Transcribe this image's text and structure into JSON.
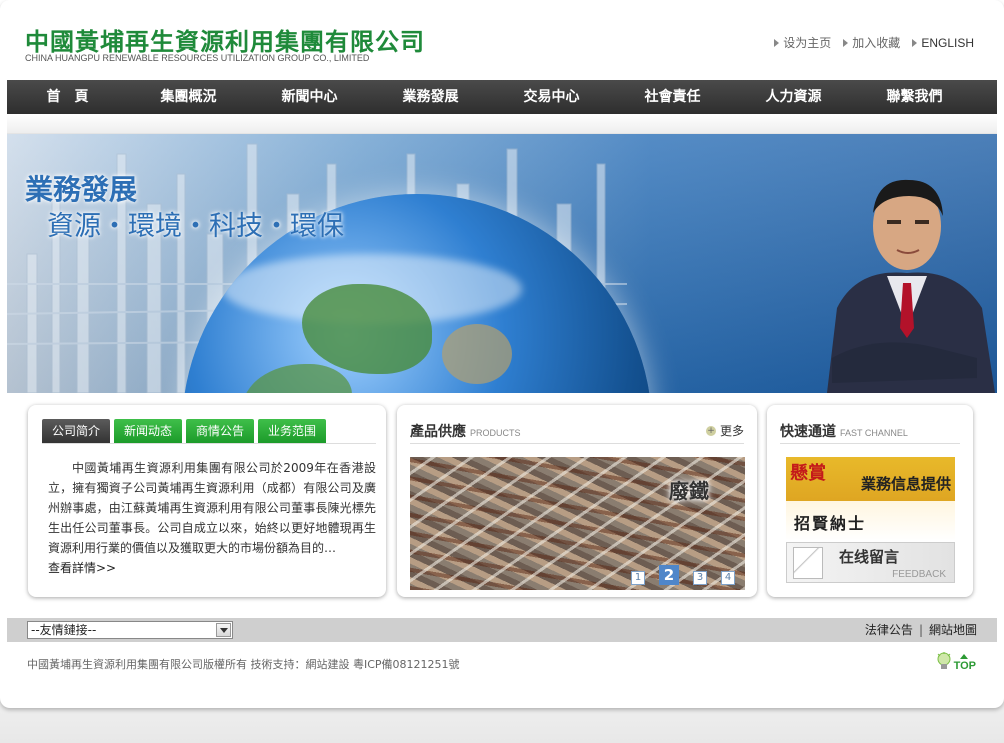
{
  "header": {
    "logo_cn": "中國黃埔再生資源利用集團有限公司",
    "logo_en": "CHINA HUANGPU RENEWABLE RESOURCES UTILIZATION GROUP CO., LIMITED",
    "top_links": [
      "设为主页",
      "加入收藏",
      "ENGLISH"
    ]
  },
  "nav": [
    "首　頁",
    "集團概況",
    "新聞中心",
    "業務發展",
    "交易中心",
    "社會責任",
    "人力資源",
    "聯繫我們"
  ],
  "banner": {
    "title": "業務發展",
    "slogan": "資源・環境・科技・環保"
  },
  "intro": {
    "tabs": [
      "公司简介",
      "新闻动态",
      "商情公告",
      "业务范围"
    ],
    "active_tab": 0,
    "text": "中國黃埔再生資源利用集團有限公司於2009年在香港設立，擁有獨資子公司黃埔再生資源利用（成都）有限公司及廣州辦事處，由江蘇黃埔再生資源利用有限公司董事長陳光標先生出任公司董事長。公司自成立以來，始終以更好地體現再生資源利用行業的價值以及獲取更大的市場份額為目的…",
    "more": "查看詳情>>"
  },
  "products": {
    "title_cn": "產品供應",
    "title_en": "PRODUCTS",
    "more": "更多",
    "image_label": "廢鐵",
    "pages": [
      "1",
      "2",
      "3",
      "4"
    ],
    "active_page": 1
  },
  "fast": {
    "title_cn": "快速通道",
    "title_en": "FAST CHANNEL",
    "banner1_reward": "懸賞",
    "banner1_text": "業務信息提供",
    "banner1_recruit": "招賢納士",
    "banner2_text": "在线留言",
    "banner2_en": "FEEDBACK"
  },
  "linkbar": {
    "select_value": "--友情鏈接--",
    "links": [
      "法律公告",
      "網站地圖"
    ],
    "separator": "|"
  },
  "footer": {
    "copyright": "中國黃埔再生資源利用集團有限公司版權所有 技術支持：網站建設 粵ICP備08121251號",
    "top": "TOP"
  },
  "colors": {
    "brand_green": "#1f8a3a",
    "nav_bg": "#333333",
    "tab_green": "#1c9b2a"
  }
}
